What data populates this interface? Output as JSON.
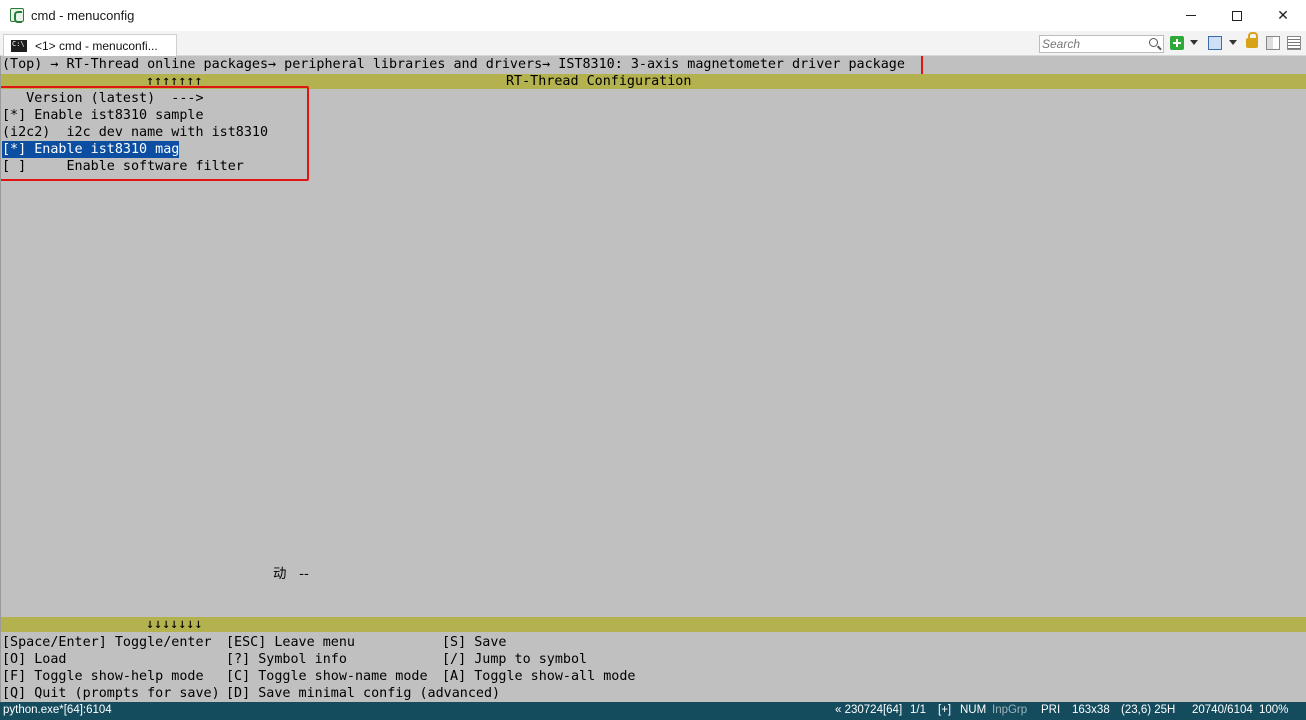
{
  "window": {
    "title": "cmd - menuconfig",
    "minimize_icon": "minimize-icon",
    "maximize_icon": "maximize-icon",
    "close_icon": "close-icon"
  },
  "toolbar": {
    "tab_label": "<1> cmd - menuconfi...",
    "search_placeholder": "Search",
    "icons": [
      "search-icon",
      "new-console-icon",
      "layout-icon",
      "lock-icon",
      "panel-icon",
      "list-icon"
    ]
  },
  "console": {
    "breadcrumb": "(Top) → RT-Thread online packages→ peripheral libraries and drivers→ IST8310: 3-axis magnetometer driver package",
    "top_scroll_arrows": "↑↑↑↑↑↑↑",
    "config_title": "RT-Thread Configuration",
    "menu_items": [
      {
        "text": "   Version (latest)  --->",
        "selected": false
      },
      {
        "text": "[*] Enable ist8310 sample",
        "selected": false
      },
      {
        "text": "(i2c2)  i2c dev name with ist8310",
        "selected": false
      },
      {
        "text": "[*] Enable ist8310 mag",
        "selected": true
      },
      {
        "text": "[ ]     Enable software filter",
        "selected": false
      }
    ],
    "ime_indicator": "动   --",
    "bottom_scroll_arrows": "↓↓↓↓↓↓↓",
    "help_rows": [
      [
        "[Space/Enter] Toggle/enter",
        "[ESC] Leave menu",
        "[S] Save"
      ],
      [
        "[O] Load",
        "[?] Symbol info",
        "[/] Jump to symbol"
      ],
      [
        "[F] Toggle show-help mode",
        "[C] Toggle show-name mode",
        "[A] Toggle show-all mode"
      ],
      [
        "[Q] Quit (prompts for save)",
        "[D] Save minimal config (advanced)",
        ""
      ]
    ]
  },
  "statusbar": {
    "process": "python.exe*[64]:6104",
    "build": "« 230724[64]",
    "pages": "1/1",
    "plus": "[+]",
    "num": "NUM",
    "inpgrp": "InpGrp",
    "pri": "PRI",
    "size": "163x38",
    "cursor": "(23,6) 25H",
    "pid": "20740/6104",
    "zoom": "100%"
  },
  "colors": {
    "console_bg": "#c0c0c0",
    "title_bar_bg": "#b4b24e",
    "selection_bg": "#0b4ea2",
    "highlight_border": "#e11414",
    "statusbar_bg": "#144b5d"
  }
}
